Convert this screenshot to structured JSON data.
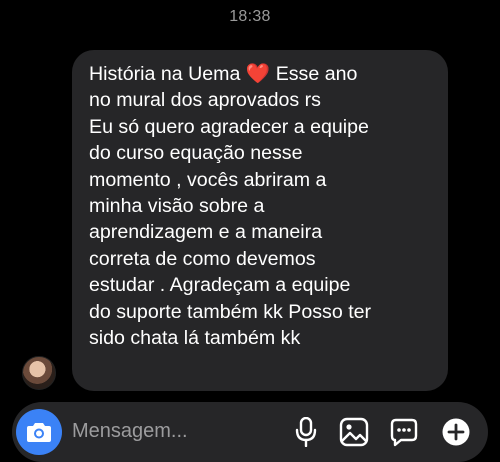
{
  "thread": {
    "timestamp": "18:38"
  },
  "message": {
    "lines": [
      "História na Uema",
      "no mural dos aprovados rs",
      "Eu só quero agradecer a equipe",
      "do curso equação nesse",
      "momento , vocês abriram a",
      "minha visão sobre a",
      "aprendizagem e a maneira",
      "correta de como devemos",
      "estudar . Agradeçam a equipe",
      "do suporte também kk Posso ter",
      "sido chata lá também kk"
    ],
    "line1_suffix": "Esse ano",
    "heart_glyph": "❤️"
  },
  "composer": {
    "placeholder": "Mensagem..."
  },
  "icons": {
    "camera": "camera-icon",
    "mic": "microphone-icon",
    "gallery": "image-icon",
    "sticker": "sticker-icon",
    "add": "plus-icon"
  },
  "colors": {
    "background": "#000000",
    "bubble": "#262628",
    "accent": "#3b82f6",
    "heart": "#ef2b35",
    "muted": "#9a9a9a"
  }
}
